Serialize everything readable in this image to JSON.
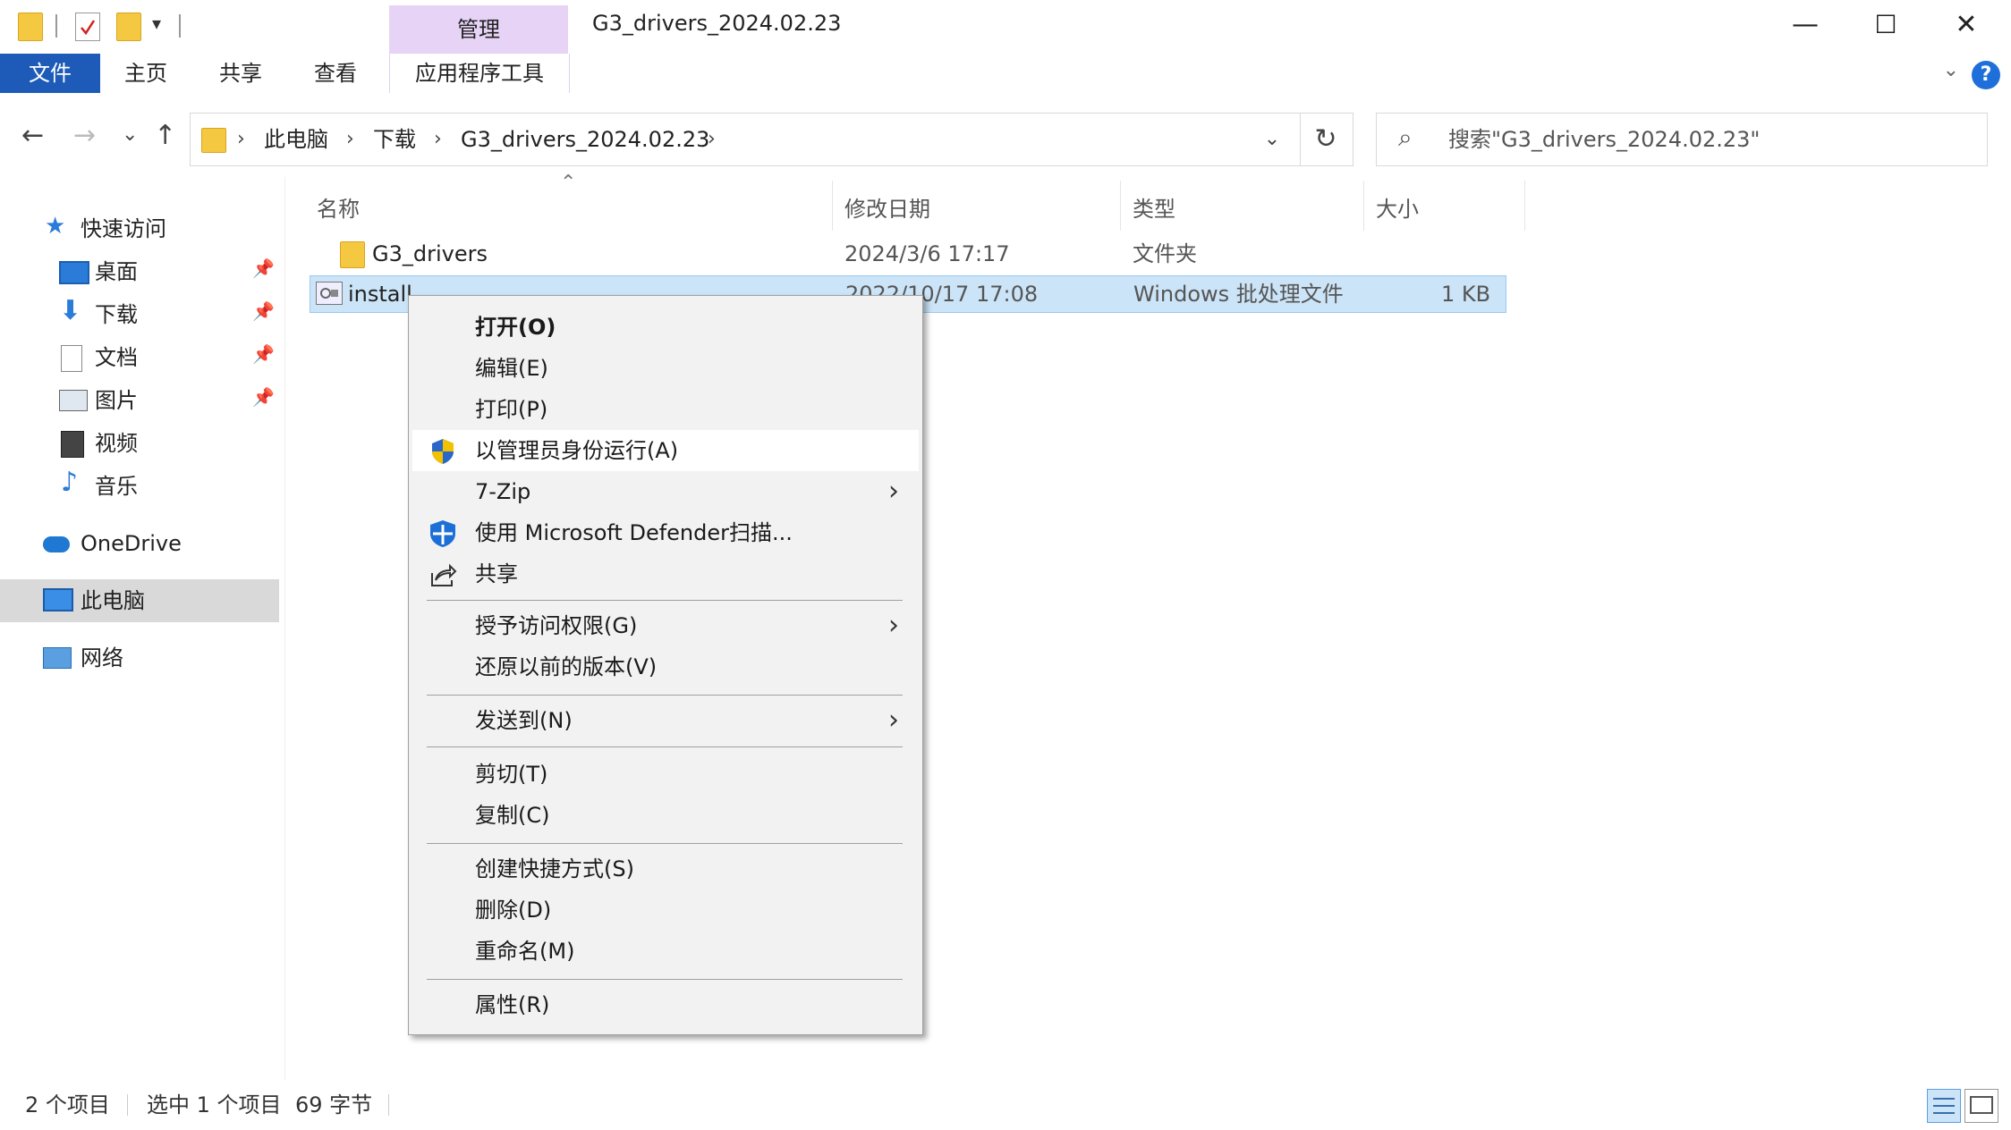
{
  "titlebar": {
    "context_tab_header": "管理",
    "window_title": "G3_drivers_2024.02.23",
    "minimize": "—",
    "maximize": "☐",
    "close": "✕"
  },
  "ribbon": {
    "tabs": [
      "文件",
      "主页",
      "共享",
      "查看"
    ],
    "context_tab": "应用程序工具",
    "help": "?"
  },
  "navbar": {
    "back": "←",
    "forward": "→",
    "recent": "⌄",
    "up": "↑",
    "breadcrumb": [
      "此电脑",
      "下载",
      "G3_drivers_2024.02.23"
    ],
    "refresh": "↻",
    "search_placeholder": "搜索\"G3_drivers_2024.02.23\""
  },
  "sidebar": {
    "quick_access": "快速访问",
    "items": [
      "桌面",
      "下载",
      "文档",
      "图片",
      "视频",
      "音乐"
    ],
    "onedrive": "OneDrive",
    "this_pc": "此电脑",
    "network": "网络"
  },
  "filelist": {
    "columns": [
      "名称",
      "修改日期",
      "类型",
      "大小"
    ],
    "rows": [
      {
        "name": "G3_drivers",
        "modified": "2024/3/6 17:17",
        "type": "文件夹",
        "size": ""
      },
      {
        "name": "install",
        "modified": "2022/10/17 17:08",
        "type": "Windows 批处理文件",
        "size": "1 KB"
      }
    ]
  },
  "context_menu": {
    "items": [
      "打开(O)",
      "编辑(E)",
      "打印(P)",
      "以管理员身份运行(A)",
      "7-Zip",
      "使用 Microsoft Defender扫描...",
      "共享",
      "授予访问权限(G)",
      "还原以前的版本(V)",
      "发送到(N)",
      "剪切(T)",
      "复制(C)",
      "创建快捷方式(S)",
      "删除(D)",
      "重命名(M)",
      "属性(R)"
    ]
  },
  "statusbar": {
    "item_count": "2 个项目",
    "selection": "选中 1 个项目",
    "size": "69 字节"
  },
  "colors": {
    "accent": "#1e5bb8",
    "selection": "#cce4f7",
    "context_tab": "#e6d3f5"
  }
}
